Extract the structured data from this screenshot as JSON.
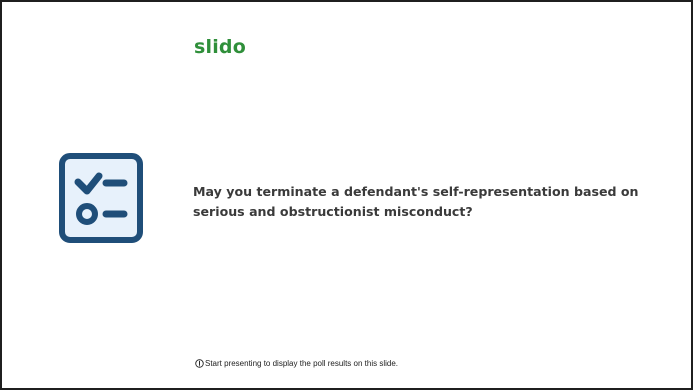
{
  "slide": {
    "brand": "slido",
    "question": "May you terminate a defendant's self-representation based on serious and obstructionist misconduct?",
    "footer_text": "Start presenting to display the poll results on this slide.",
    "icons": {
      "poll": "poll-checklist-icon",
      "info": "info-icon"
    },
    "colors": {
      "brand": "#2f8f3a",
      "icon_stroke": "#1f4e79",
      "icon_fill": "#e7f1fb",
      "question_text": "#3a3a3a"
    }
  }
}
